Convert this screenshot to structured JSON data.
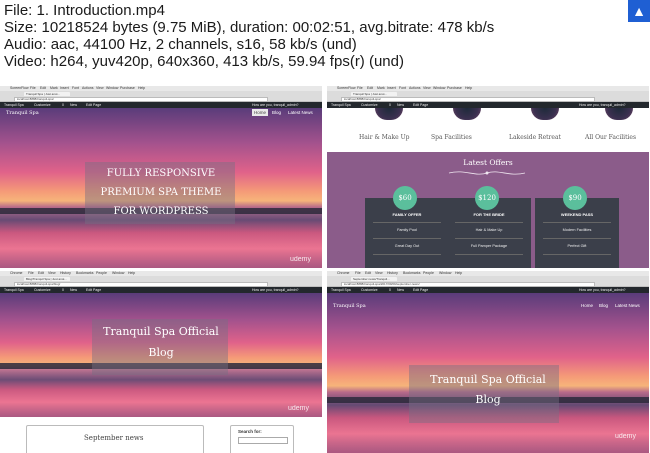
{
  "info": {
    "line1": "File: 1. Introduction.mp4",
    "line2": "Size: 10218524 bytes (9.75 MiB), duration: 00:02:51, avg.bitrate: 478 kb/s",
    "line3": "Audio: aac, 44100 Hz, 2 channels, s16, 58 kb/s (und)",
    "line4": "Video: h264, yuv420p, 640x360, 413 kb/s, 59.94 fps(r) (und)"
  },
  "corner_icon": "help-icon",
  "colors": {
    "accent": "#1f5fd3",
    "offers_bg": "#8b5c8a",
    "badge": "#5bbf9c",
    "card": "#3b3f4a",
    "wp_bar": "#23282d"
  },
  "p1": {
    "mac_menu": [
      "ScreenFlow",
      "File",
      "Edit",
      "Mark",
      "Insert",
      "Font",
      "Actions",
      "View",
      "Window",
      "Purchase",
      "Help"
    ],
    "tab": "Tranquil Spa | Just anot...",
    "url": "localhost:8888/tranquil-spa/",
    "wp": [
      "Tranquil Spa",
      "Customize",
      "0",
      "New",
      "Edit Page"
    ],
    "wp_right": "How are you, tranquil_admin?",
    "site_title": "Tranquil Spa",
    "nav": [
      "Home",
      "Blog",
      "Latest News"
    ],
    "hero": [
      "FULLY RESPONSIVE",
      "PREMIUM SPA THEME",
      "FOR WORDPRESS"
    ],
    "udemy": "udemy"
  },
  "p2": {
    "mac_menu": [
      "ScreenFlow",
      "File",
      "Edit",
      "Mark",
      "Insert",
      "Font",
      "Actions",
      "View",
      "Window",
      "Purchase",
      "Help"
    ],
    "tab": "Tranquil Spa | Just anot...",
    "url": "localhost:8888/tranquil-spa/",
    "wp": [
      "Tranquil Spa",
      "Customize",
      "0",
      "New",
      "Edit Page"
    ],
    "wp_right": "How are you, tranquil_admin?",
    "services": [
      "Hair & Make Up",
      "Spa Facilities",
      "Lakeside Retreat",
      "All Our Facilities"
    ],
    "offers_title": "Latest Offers",
    "cards": [
      {
        "price": "$60",
        "name": "FAMILY OFFER",
        "items": [
          "Family Pool",
          "Great Day Out"
        ]
      },
      {
        "price": "$120",
        "name": "FOR THE BRIDE",
        "items": [
          "Hair & Make Up",
          "Full Pamper Package"
        ]
      },
      {
        "price": "$90",
        "name": "WEEKEND PASS",
        "items": [
          "Modern Facilities",
          "Perfect Gift"
        ]
      }
    ]
  },
  "p3": {
    "mac_menu": [
      "Chrome",
      "File",
      "Edit",
      "View",
      "History",
      "Bookmarks",
      "People",
      "Window",
      "Help"
    ],
    "tab": "Blog/Tranquil Spa | Just anot...",
    "url": "localhost:8888/tranquil-spa/blog/",
    "wp": [
      "Tranquil Spa",
      "Customize",
      "0",
      "New",
      "Edit Page"
    ],
    "wp_right": "How are you, tranquil_admin?",
    "hero": [
      "Tranquil Spa Official",
      "Blog"
    ],
    "udemy": "udemy",
    "post_title": "September news",
    "search_label": "Search for:"
  },
  "p4": {
    "mac_menu": [
      "Chrome",
      "File",
      "Edit",
      "View",
      "History",
      "Bookmarks",
      "People",
      "Window",
      "Help"
    ],
    "tab": "September news/Tranquil...",
    "url": "localhost:8888/tranquil-spa/2017/09/09/september-news/",
    "wp": [
      "Tranquil Spa",
      "Customize",
      "0",
      "New",
      "Edit Page"
    ],
    "wp_right": "How are you, tranquil_admin?",
    "site_title": "Tranquil Spa",
    "nav": [
      "Home",
      "Blog",
      "Latest News"
    ],
    "hero": [
      "Tranquil Spa Official",
      "Blog"
    ],
    "udemy": "udemy"
  }
}
